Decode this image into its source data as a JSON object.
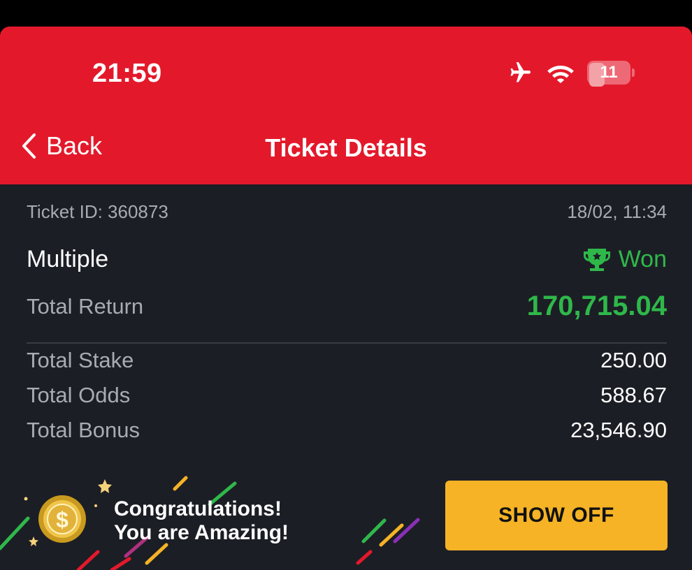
{
  "status_bar": {
    "time": "21:59",
    "battery_level": "11",
    "icons": [
      "airplane-icon",
      "wifi-icon",
      "battery-icon"
    ]
  },
  "nav": {
    "back_label": "Back",
    "title": "Ticket Details"
  },
  "ticket": {
    "id_label": "Ticket ID: 360873",
    "datetime": "18/02, 11:34",
    "type": "Multiple",
    "status": "Won",
    "total_return_label": "Total Return",
    "total_return": "170,715.04",
    "rows": [
      {
        "label": "Total Stake",
        "value": "250.00"
      },
      {
        "label": "Total Odds",
        "value": "588.67"
      },
      {
        "label": "Total Bonus",
        "value": "23,546.90"
      }
    ]
  },
  "promo": {
    "line1": "Congratulations!",
    "line2": "You are Amazing!",
    "button_label": "SHOW OFF"
  },
  "colors": {
    "header": "#e3192b",
    "background": "#1c1e25",
    "won_green": "#2fb84a",
    "button": "#f5b325"
  }
}
